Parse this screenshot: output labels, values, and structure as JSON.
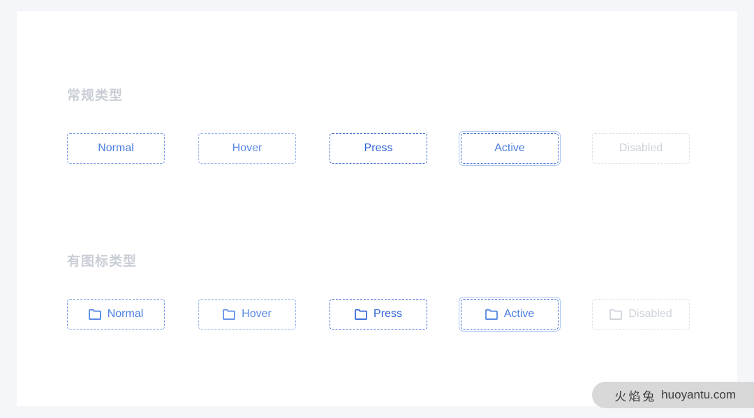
{
  "theme": {
    "page_background": "#f4f6fa",
    "card_background": "#ffffff",
    "accent": "#4a7fe0",
    "accent_press": "#2f62d4",
    "accent_border_active": "#3f6ed6",
    "disabled_text": "#cdd2da",
    "disabled_border": "#dde1e7",
    "heading_color": "#c9ced6"
  },
  "sections": [
    {
      "id": "normal-type",
      "title": "常规类型",
      "buttons": [
        {
          "state": "normal",
          "label": "Normal",
          "icon": null
        },
        {
          "state": "hover",
          "label": "Hover",
          "icon": null
        },
        {
          "state": "press",
          "label": "Press",
          "icon": null
        },
        {
          "state": "active",
          "label": "Active",
          "icon": null
        },
        {
          "state": "disabled",
          "label": "Disabled",
          "icon": null
        }
      ]
    },
    {
      "id": "icon-type",
      "title": "有图标类型",
      "buttons": [
        {
          "state": "normal",
          "label": "Normal",
          "icon": "folder-icon"
        },
        {
          "state": "hover",
          "label": "Hover",
          "icon": "folder-icon"
        },
        {
          "state": "press",
          "label": "Press",
          "icon": "folder-icon"
        },
        {
          "state": "active",
          "label": "Active",
          "icon": "folder-icon"
        },
        {
          "state": "disabled",
          "label": "Disabled",
          "icon": "folder-icon"
        }
      ]
    }
  ],
  "watermark": {
    "brand_cn": "火焰兔",
    "brand_en": "huoyantu.com"
  }
}
